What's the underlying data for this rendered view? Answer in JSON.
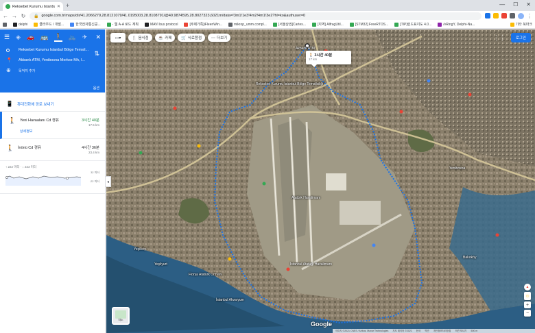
{
  "browser": {
    "tab_title": "Reksebet Kurumu İstanbul Bölge",
    "url": "google.com.tr/maps/dir/41.2066279,28.8121079/41.0195003,28.8108791/@40.9874595,28.8027323,6021m/data=!3m1!1e3!4m2!4m1!3e2?hl=ko&authuser=0",
    "bookmarks": [
      "delphi",
      "클라우드 / 개발...",
      "한국전자통신공...",
      "- 웹 A-A 로드 계획",
      "MAVI bus protocol",
      "[주제가족]iFleenWin...",
      "mikrop_umm.compl...",
      "[서울상권]Cartes...",
      "[지역] AlfragUtil...",
      "[STM32] FreeRTOS...",
      "[TIP]런드표지도 4.0...",
      "/vRingY, Delphi-Na..."
    ],
    "other_bookmarks": "기타 북마크",
    "icons": [
      "logo-icon",
      "route-marker-icon"
    ]
  },
  "sidebar": {
    "origin": "Reksebet Kurumu İstanbul Bölge Temsil...",
    "destination": "Akbank ATM, Yenibosna Merkez Mh, I...",
    "add_destination": "목적지 추가",
    "options": "옵션",
    "send_to_phone": "휴대전화에 경로 보내기",
    "routes": [
      {
        "via": "Yeni Havaalanı Cd 경유",
        "time": "3시간 40분",
        "distance": "17.5 km",
        "details": "상세정보"
      },
      {
        "via": "İnönü Cd 경유",
        "time": "4시간 36분",
        "distance": "23.4 km"
      }
    ],
    "elevation": {
      "stats": "↑ 222 미터 · ↓ 223 미터",
      "high": "32 미터",
      "low": "-22 미터"
    }
  },
  "map": {
    "chips": [
      {
        "icon": "restaurant-icon",
        "label": "음식점"
      },
      {
        "icon": "coffee-icon",
        "label": "카페"
      },
      {
        "icon": "shopping-cart-icon",
        "label": "식료품점"
      },
      {
        "icon": "more-icon",
        "label": "더보기"
      }
    ],
    "login_button": "로그인",
    "callout": {
      "time": "3시간 40분",
      "distance": "17 km"
    },
    "labels": [
      "Akbank ATM",
      "Reksebet Kurumu İstanbul Bölge Temsilciliği",
      "Yeşilköy",
      "Atatürk Havalimanı",
      "İstanbul Atatürk Havalimanı",
      "Yenibosna",
      "Bakırköy",
      "Florya Atatürk Ormanı",
      "İstanbul Akvaryum",
      "Yeşilyurt"
    ],
    "layer_label": "지도",
    "google_logo": "Google",
    "footer": [
      "이미지 ©2021 CNES / Airbus, Maxar Technologies",
      "지도 데이터 ©2021",
      "한국",
      "약관",
      "개인정보처리방침",
      "의견 보내기",
      "500 m"
    ]
  }
}
